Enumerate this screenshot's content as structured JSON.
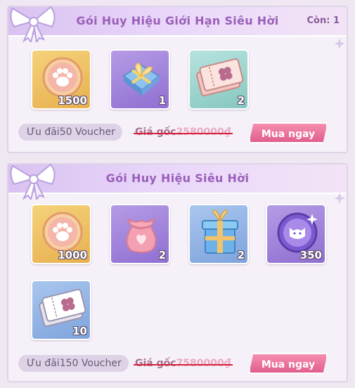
{
  "colors": {
    "title": "#9a5fb8",
    "buy_button": "#e05d8c",
    "strike": "#d6233a"
  },
  "packs": [
    {
      "title": "Gói Huy Hiệu Giới Hạn Siêu Hời",
      "remaining": "Còn: 1",
      "items": [
        {
          "icon": "paw-coin-icon",
          "qty": "1500"
        },
        {
          "icon": "puzzle-gift-icon",
          "qty": "1"
        },
        {
          "icon": "clover-ticket-icon",
          "qty": "2"
        }
      ],
      "voucher": "Ưu đãi50 Voucher",
      "original_price_label": "Giá gốc",
      "original_price": "2580000₫",
      "buy_label": "Mua ngay"
    },
    {
      "title": "Gói Huy Hiệu Siêu Hời",
      "items": [
        {
          "icon": "paw-coin-icon",
          "qty": "1000"
        },
        {
          "icon": "heart-pouch-icon",
          "qty": "2"
        },
        {
          "icon": "gift-box-icon",
          "qty": "2"
        },
        {
          "icon": "cat-coin-icon",
          "qty": "350"
        },
        {
          "icon": "clover-ticket-icon",
          "qty": "10"
        }
      ],
      "voucher": "Ưu đãi150 Voucher",
      "original_price_label": "Giá gốc",
      "original_price": "7580000₫",
      "buy_label": "Mua ngay"
    }
  ]
}
